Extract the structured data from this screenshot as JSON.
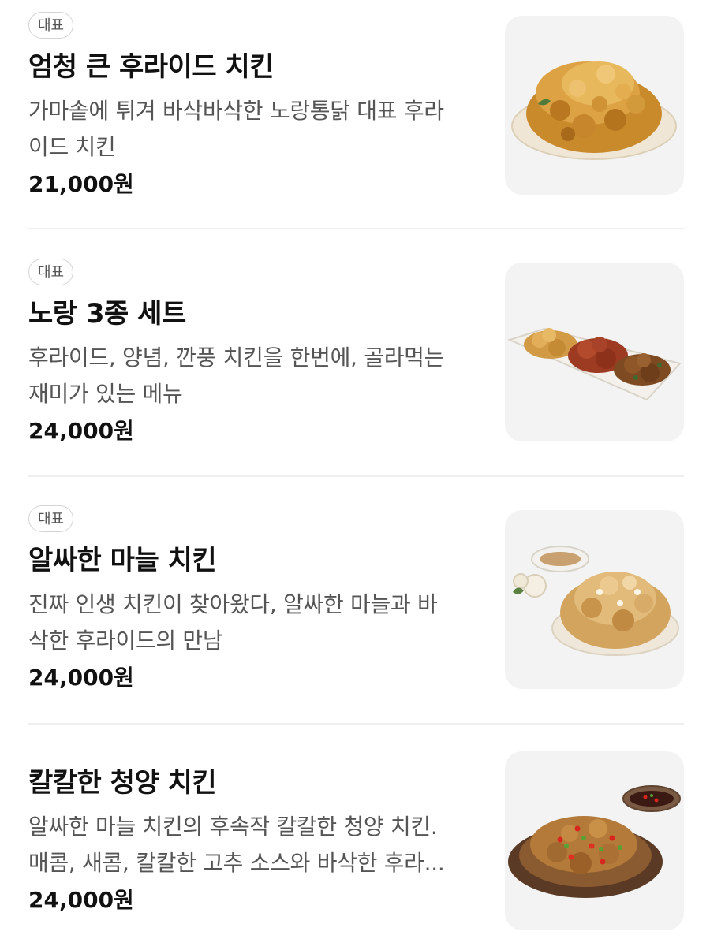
{
  "menu": {
    "items": [
      {
        "badge": "대표",
        "name": "엄청 큰 후라이드 치킨",
        "desc_lines": [
          "가마솥에 튀겨 바삭바삭한 노랑통닭 대표 후라",
          "이드 치킨"
        ],
        "price": "21,000원",
        "image_icon": "fried-chicken-plate"
      },
      {
        "badge": "대표",
        "name": "노랑 3종 세트",
        "desc_lines": [
          "후라이드, 양념, 깐풍 치킨을 한번에, 골라먹는",
          "재미가 있는 메뉴"
        ],
        "price": "24,000원",
        "image_icon": "three-chicken-set-tray"
      },
      {
        "badge": "대표",
        "name": "알싸한 마늘 치킨",
        "desc_lines": [
          "진짜 인생 치킨이 찾아왔다, 알싸한 마늘과 바",
          "삭한 후라이드의 만남"
        ],
        "price": "24,000원",
        "image_icon": "garlic-chicken-plate"
      },
      {
        "badge": "",
        "name": "칼칼한 청양 치킨",
        "desc_lines": [
          "알싸한 마늘 치킨의 후속작 칼칼한 청양 치킨.",
          "매콤, 새콤, 칼칼한 고추 소스와 바삭한 후라..."
        ],
        "price": "24,000원",
        "image_icon": "spicy-pepper-chicken-plate"
      }
    ]
  },
  "colors": {
    "background": "#ffffff",
    "title": "#111111",
    "description": "#555555",
    "badge_border": "#d4d4d4",
    "thumb_bg": "#f3f3f3",
    "divider": "#efefef"
  }
}
